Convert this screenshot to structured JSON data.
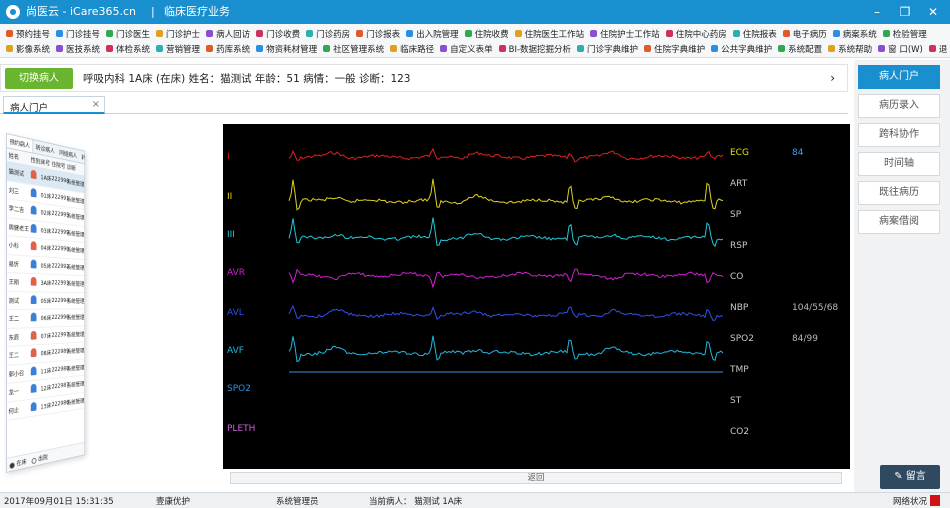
{
  "titlebar": {
    "title": "尚医云 - iCare365.cn",
    "separator": "|",
    "subtitle": "临床医疗业务",
    "min_icon": "–",
    "restore_icon": "❐",
    "close_icon": "✕"
  },
  "menu": {
    "row1": [
      "预约挂号",
      "门诊挂号",
      "门诊医生",
      "门诊护士",
      "病人回访",
      "门诊收费",
      "门诊药房",
      "门诊报表",
      "出入院管理",
      "住院收费",
      "住院医生工作站",
      "住院护士工作站",
      "住院中心药房",
      "住院报表",
      "电子病历",
      "病案系统",
      "检验管理"
    ],
    "row2": [
      "影像系统",
      "医技系统",
      "体检系统",
      "营销管理",
      "药库系统",
      "物资耗材管理",
      "社区管理系统",
      "临床路径",
      "自定义表单",
      "BI-数据挖掘分析",
      "门诊字典维护",
      "住院字典维护",
      "公共字典维护",
      "系统配置",
      "系统帮助",
      "窗 口(W)",
      "退 出(X)"
    ]
  },
  "patient_bar": {
    "switch_label": "切换病人",
    "info": "呼吸内科 1A床 (在床)  姓名：猫测试  年龄：51  病情：一般  诊断：123",
    "more_icon": "›"
  },
  "tabs": [
    {
      "label": "病人门户",
      "close": "×"
    }
  ],
  "right_menu": [
    {
      "label": "病人门户",
      "active": true
    },
    {
      "label": "病历录入",
      "active": false
    },
    {
      "label": "跨科协作",
      "active": false
    },
    {
      "label": "时间轴",
      "active": false
    },
    {
      "label": "既往病历",
      "active": false
    },
    {
      "label": "病案借阅",
      "active": false
    }
  ],
  "message_button": "留言",
  "patient_list": {
    "tabs": [
      "预约病人",
      "转诊病人",
      "同组病人",
      "转出病人"
    ],
    "headers": [
      "姓名",
      "性别",
      "床号",
      "住院号",
      "诊断"
    ],
    "rows": [
      {
        "name": "猫测试",
        "gender": "female",
        "bed": "1A床",
        "id": "222998",
        "diag": "系统管理员"
      },
      {
        "name": "刘三",
        "gender": "male",
        "bed": "01床",
        "id": "222991",
        "diag": "系统管理员"
      },
      {
        "name": "李二吉",
        "gender": "male",
        "bed": "02床",
        "id": "222995",
        "diag": "系统管理员"
      },
      {
        "name": "周健老王",
        "gender": "male",
        "bed": "03床",
        "id": "222999",
        "diag": "系统管理员"
      },
      {
        "name": "小杉",
        "gender": "female",
        "bed": "04床",
        "id": "222990",
        "diag": "系统管理员"
      },
      {
        "name": "易忻",
        "gender": "male",
        "bed": "05床",
        "id": "222992",
        "diag": "系统管理员"
      },
      {
        "name": "王刚",
        "gender": "female",
        "bed": "3A床",
        "id": "222993",
        "diag": "系统管理员"
      },
      {
        "name": "测试",
        "gender": "male",
        "bed": "05床",
        "id": "222994",
        "diag": "系统管理员"
      },
      {
        "name": "王二",
        "gender": "male",
        "bed": "06床",
        "id": "222996",
        "diag": "系统管理员"
      },
      {
        "name": "东辰",
        "gender": "female",
        "bed": "07床",
        "id": "222997",
        "diag": "系统管理员"
      },
      {
        "name": "王二",
        "gender": "female",
        "bed": "08床",
        "id": "222989",
        "diag": "系统管理员"
      },
      {
        "name": "郭小召",
        "gender": "male",
        "bed": "11床",
        "id": "222988",
        "diag": "系统管理员"
      },
      {
        "name": "龙一",
        "gender": "male",
        "bed": "12床",
        "id": "222987",
        "diag": "系统管理员"
      },
      {
        "name": "何止",
        "gender": "male",
        "bed": "13床",
        "id": "222986",
        "diag": "系统管理员"
      }
    ],
    "footer": [
      "在床",
      "出院"
    ]
  },
  "monitor": {
    "leads": [
      {
        "label": "I",
        "color": "#e02020"
      },
      {
        "label": "II",
        "color": "#e0d020"
      },
      {
        "label": "III",
        "color": "#20c8d8"
      },
      {
        "label": "AVR",
        "color": "#d020d0"
      },
      {
        "label": "AVL",
        "color": "#3050e8"
      },
      {
        "label": "AVF",
        "color": "#20b8e0"
      },
      {
        "label": "SPO2",
        "color": "#2a8fe0"
      },
      {
        "label": "PLETH",
        "color": "#d060d8"
      }
    ],
    "params": [
      {
        "label": "ECG",
        "value": "84",
        "color": "#e0e020",
        "vcolor": "#3aa0ff"
      },
      {
        "label": "ART",
        "value": ""
      },
      {
        "label": "SP",
        "value": ""
      },
      {
        "label": "RSP",
        "value": ""
      },
      {
        "label": "CO",
        "value": ""
      },
      {
        "label": "NBP",
        "value": "104/55/68"
      },
      {
        "label": "SPO2",
        "value": "84/99"
      },
      {
        "label": "TMP",
        "value": ""
      },
      {
        "label": "ST",
        "value": ""
      },
      {
        "label": "CO2",
        "value": ""
      }
    ],
    "back_label": "返回"
  },
  "statusbar": {
    "datetime": "2017年09月01日 15:31:35",
    "company": "壹康优护",
    "user": "系统管理员",
    "current_patient": "当前病人：  猫测试    1A床",
    "network": "网络状况",
    "network_color": "#d01414"
  }
}
